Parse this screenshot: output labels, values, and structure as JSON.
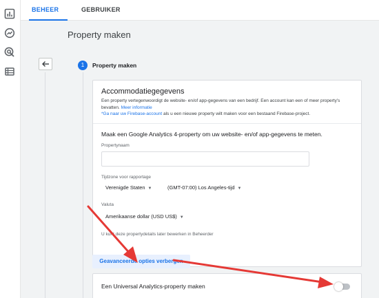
{
  "sidebar": {
    "icons": [
      "bar-chart-icon",
      "explore-icon",
      "target-icon",
      "list-icon"
    ]
  },
  "tabs": [
    {
      "label": "BEHEER",
      "active": true
    },
    {
      "label": "GEBRUIKER",
      "active": false
    }
  ],
  "page": {
    "title": "Property maken"
  },
  "step": {
    "number": "1",
    "title": "Property maken"
  },
  "account_section": {
    "title": "Accommodatiegegevens",
    "description_1": "Een property vertegenwoordigt de website- en/of app-gegevens van een bedrijf. Een account kan een of meer property's bevatten.",
    "more_info": "Meer informatie",
    "firebase_link": "*Ga naar uw Firebase-account",
    "description_2": " als u een nieuwe property wilt maken voor een bestaand Firebase-project."
  },
  "form": {
    "intro": "Maak een Google Analytics 4-property om uw website- en/of app-gegevens te meten.",
    "property_name_label": "Propertynaam",
    "property_name_value": "",
    "timezone_label": "Tijdzone voor rapportage",
    "timezone_country": "Verenigde Staten",
    "timezone_value": "(GMT-07:00) Los Angeles-tijd",
    "currency_label": "Valuta",
    "currency_value": "Amerikaanse dollar (USD US$)",
    "note": "U kunt deze propertydetails later bewerken in Beheerder"
  },
  "advanced": {
    "button_label": "Geavanceerde opties verbergen",
    "ua_label": "Een Universal Analytics-property maken",
    "ua_toggle_on": false
  },
  "colors": {
    "accent": "#1a73e8",
    "annotation": "#e53935",
    "background": "#f1f3f4"
  }
}
